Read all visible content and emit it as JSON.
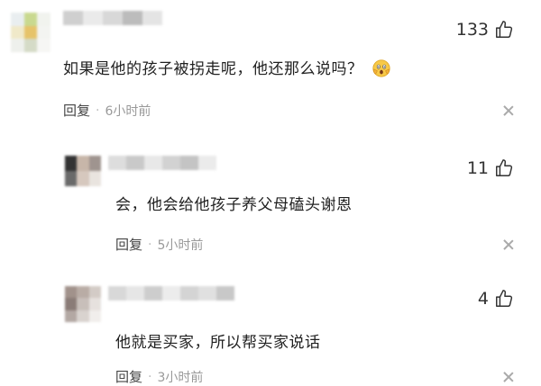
{
  "comments": [
    {
      "text": "如果是他的孩子被拐走呢，他还那么说吗？",
      "emoji": "scared-face-emoji",
      "likes": "133",
      "reply_label": "回复",
      "separator": "·",
      "time": "6小时前"
    },
    {
      "text": "会，他会给他孩子养父母磕头谢恩",
      "likes": "11",
      "reply_label": "回复",
      "separator": "·",
      "time": "5小时前"
    },
    {
      "text": "他就是买家，所以帮买家说话",
      "likes": "4",
      "reply_label": "回复",
      "separator": "·",
      "time": "3小时前"
    }
  ],
  "colors": {
    "avatar1": [
      "#e9eef0",
      "#c9d98f",
      "#f1f3ee",
      "#f0e9c9",
      "#e6c36a",
      "#f3f4f1",
      "#eef0ec",
      "#d5dbc7",
      "#f6f6f4"
    ],
    "avatar2": [
      "#333333",
      "#c7b6a9",
      "#9f948f",
      "#6a6a6a",
      "#d6c8be",
      "#e9e4df"
    ],
    "avatar3": [
      "#a1928b",
      "#b9aca5",
      "#d3cbc6",
      "#8a7c77",
      "#c8bfba",
      "#e6e1de",
      "#b3a8a3",
      "#d9d3cf",
      "#f1eeec"
    ],
    "name1": [
      "#cfcfcf",
      "#eaeaea",
      "#d8d8d8",
      "#bcbcbc",
      "#e4e4e4"
    ],
    "name2": [
      "#dddddd",
      "#c9c9c9",
      "#e8e8e8",
      "#d2d2d2",
      "#c4c4c4",
      "#ebebeb"
    ],
    "name3": [
      "#d8d8d8",
      "#e6e6e6",
      "#cdcdcd",
      "#ececec",
      "#d4d4d4",
      "#e0e0e0",
      "#c8c8c8"
    ]
  }
}
